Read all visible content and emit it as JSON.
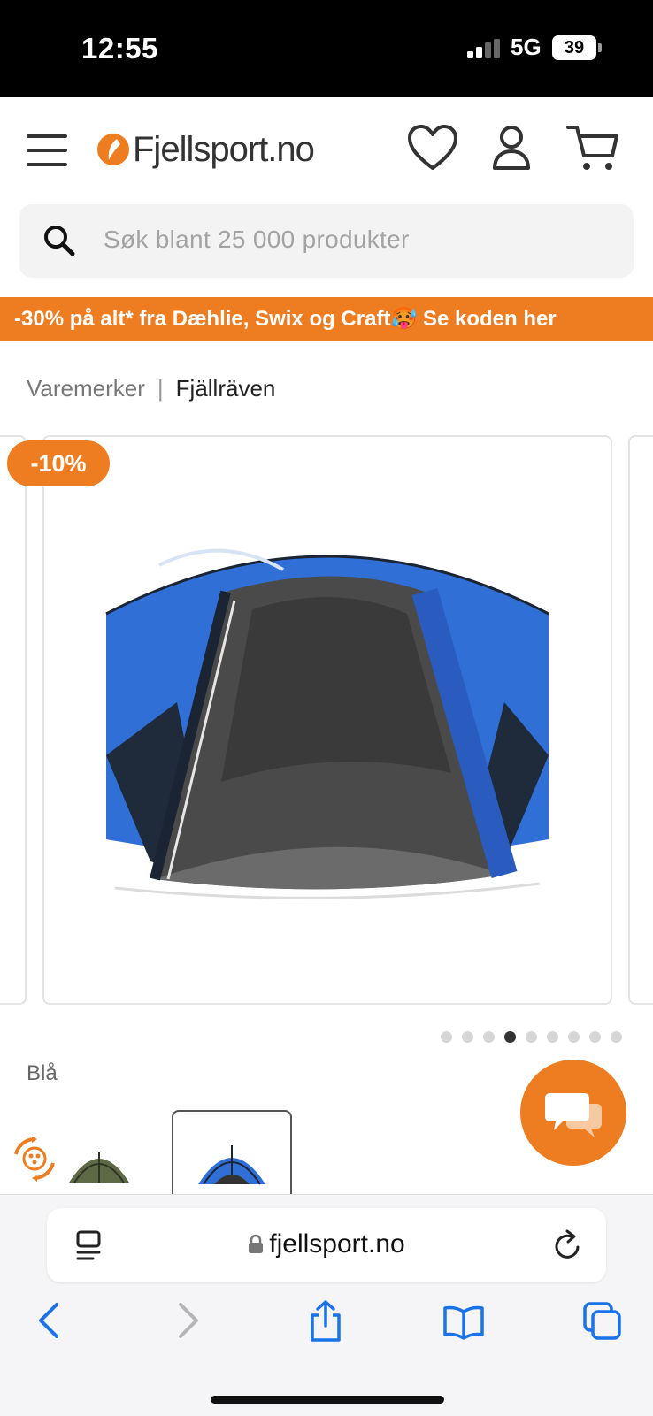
{
  "status_bar": {
    "time": "12:55",
    "network": "5G",
    "battery": "39"
  },
  "header": {
    "logo_text": "Fjellsport.no"
  },
  "search": {
    "placeholder": "Søk blant 25 000 produkter"
  },
  "promo": {
    "text": "-30% på alt* fra Dæhlie, Swix og Craft🥵 Se koden her"
  },
  "breadcrumb": {
    "parent": "Varemerker",
    "separator": "|",
    "current": "Fjällräven"
  },
  "product": {
    "discount_badge": "-10%",
    "color_label": "Blå",
    "carousel_total": 9,
    "carousel_active_index": 3
  },
  "browser": {
    "url": "fjellsport.no"
  },
  "colors": {
    "brand_orange": "#ee7d22",
    "tent_blue": "#2f6fd6",
    "ios_blue": "#1a73e8"
  }
}
